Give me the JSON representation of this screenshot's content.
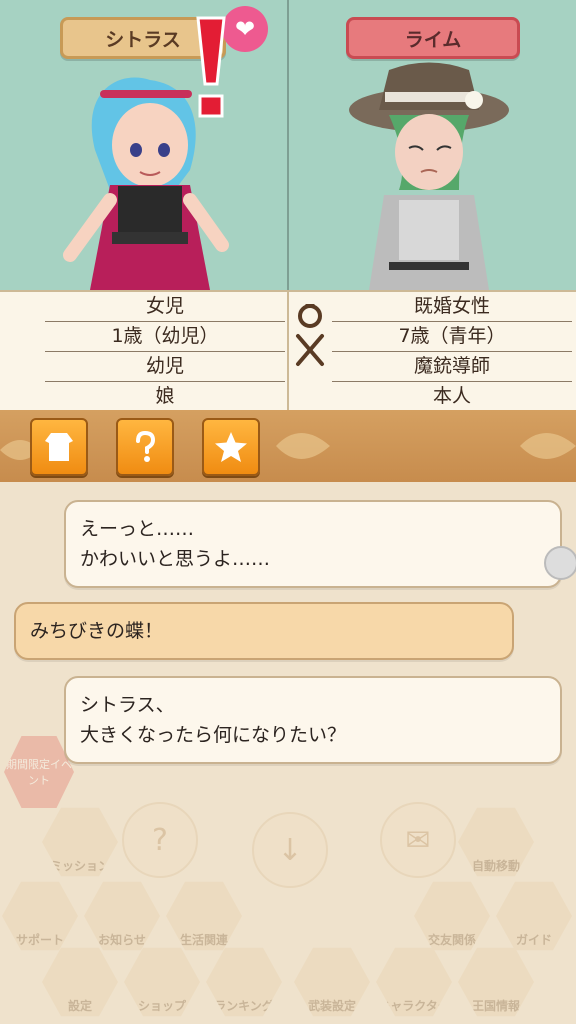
{
  "characters": {
    "left": {
      "name": "シトラス"
    },
    "right": {
      "name": "ライム"
    }
  },
  "info": {
    "left": [
      "女児",
      "1歳（幼児）",
      "幼児",
      "娘"
    ],
    "right": [
      "既婚女性",
      "7歳（青年）",
      "魔銃導師",
      "本人"
    ]
  },
  "toolbar": {
    "buttons": [
      "clothes-icon",
      "question-icon",
      "star-icon"
    ]
  },
  "chat": {
    "messages": [
      {
        "lines": [
          "えーっと……",
          "かわいいと思うよ……"
        ]
      },
      {
        "lines": [
          "みちびきの蝶！"
        ]
      },
      {
        "lines": [
          "シトラス、",
          "大きくなったら何になりたい？"
        ]
      }
    ]
  },
  "faded_menu": {
    "event_badge": "期間限定イベント",
    "items": [
      "ミッション",
      "自動移動",
      "サポート",
      "お知らせ",
      "生活関連",
      "交友関係",
      "ガイド",
      "設定",
      "ショップ",
      "ランキング",
      "武装設定",
      "キャラクター",
      "王国情報"
    ]
  },
  "colors": {
    "portrait_bg": "#a6d2c2",
    "name_left_bg": "#e8c58c",
    "name_right_bg": "#e77a7d",
    "toolbar_bg": "#d5a061",
    "button_orange": "#f08c12"
  }
}
